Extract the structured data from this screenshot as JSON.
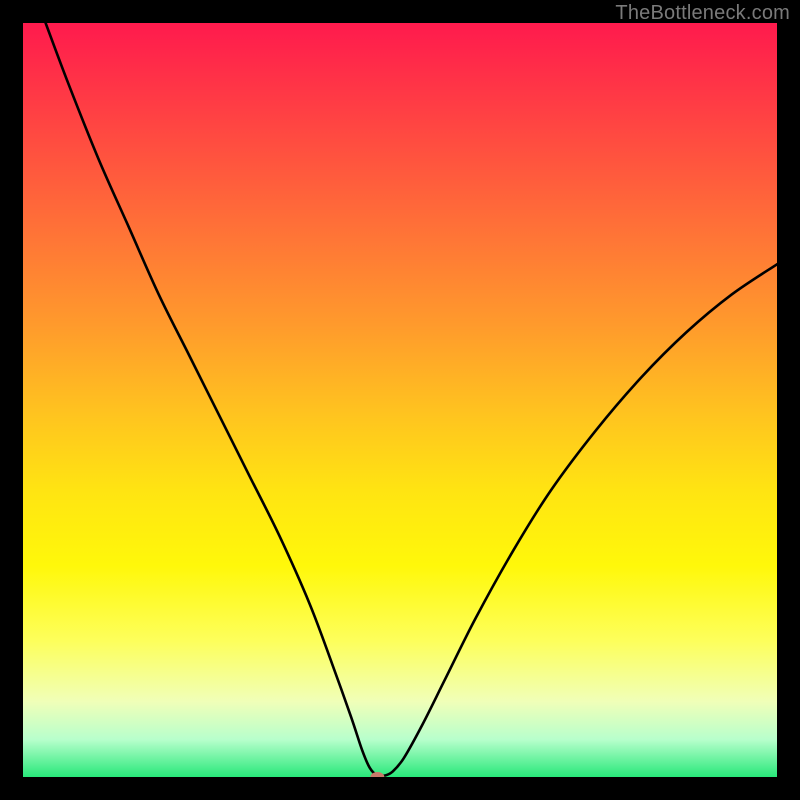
{
  "watermark": "TheBottleneck.com",
  "chart_data": {
    "type": "line",
    "title": "",
    "xlabel": "",
    "ylabel": "",
    "x_range": [
      0,
      100
    ],
    "y_range": [
      0,
      100
    ],
    "grid": false,
    "legend": false,
    "marker": {
      "x": 47,
      "y": 0,
      "color": "#c87a6a"
    },
    "series": [
      {
        "name": "curve",
        "x": [
          3,
          6,
          10,
          14,
          18,
          22,
          26,
          30,
          34,
          38,
          41,
          43.5,
          45,
          46,
          47,
          48,
          49,
          50.5,
          53,
          56,
          60,
          65,
          70,
          76,
          82,
          88,
          94,
          100
        ],
        "y": [
          100,
          92,
          82,
          73,
          64,
          56,
          48,
          40,
          32,
          23,
          15,
          8,
          3.5,
          1.2,
          0.2,
          0.2,
          0.7,
          2.5,
          7,
          13,
          21,
          30,
          38,
          46,
          53,
          59,
          64,
          68
        ]
      }
    ]
  }
}
